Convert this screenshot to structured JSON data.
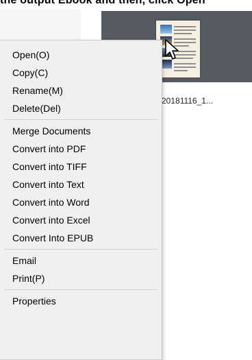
{
  "header": {
    "caption_fragment": "the output Ebook and then, click Open"
  },
  "file": {
    "name": "20181116_1..."
  },
  "icons": {
    "cursor": "mouse-pointer-icon",
    "thumbnail": "document-thumbnail-icon"
  },
  "colors": {
    "tile_background": "#555b60",
    "menu_background": "#f0f0f0",
    "separator": "#d2d2d2"
  },
  "context_menu": {
    "group1": [
      {
        "label": "Open(O)"
      },
      {
        "label": "Copy(C)"
      },
      {
        "label": "Rename(M)"
      },
      {
        "label": "Delete(Del)"
      }
    ],
    "group2": [
      {
        "label": "Merge Documents"
      },
      {
        "label": "Convert into PDF"
      },
      {
        "label": "Convert into TIFF"
      },
      {
        "label": "Convert into Text"
      },
      {
        "label": "Convert into Word"
      },
      {
        "label": "Convert into Excel"
      },
      {
        "label": "Convert Into EPUB"
      }
    ],
    "group3": [
      {
        "label": "Email"
      },
      {
        "label": "Print(P)"
      }
    ],
    "group4": [
      {
        "label": "Properties"
      }
    ]
  }
}
